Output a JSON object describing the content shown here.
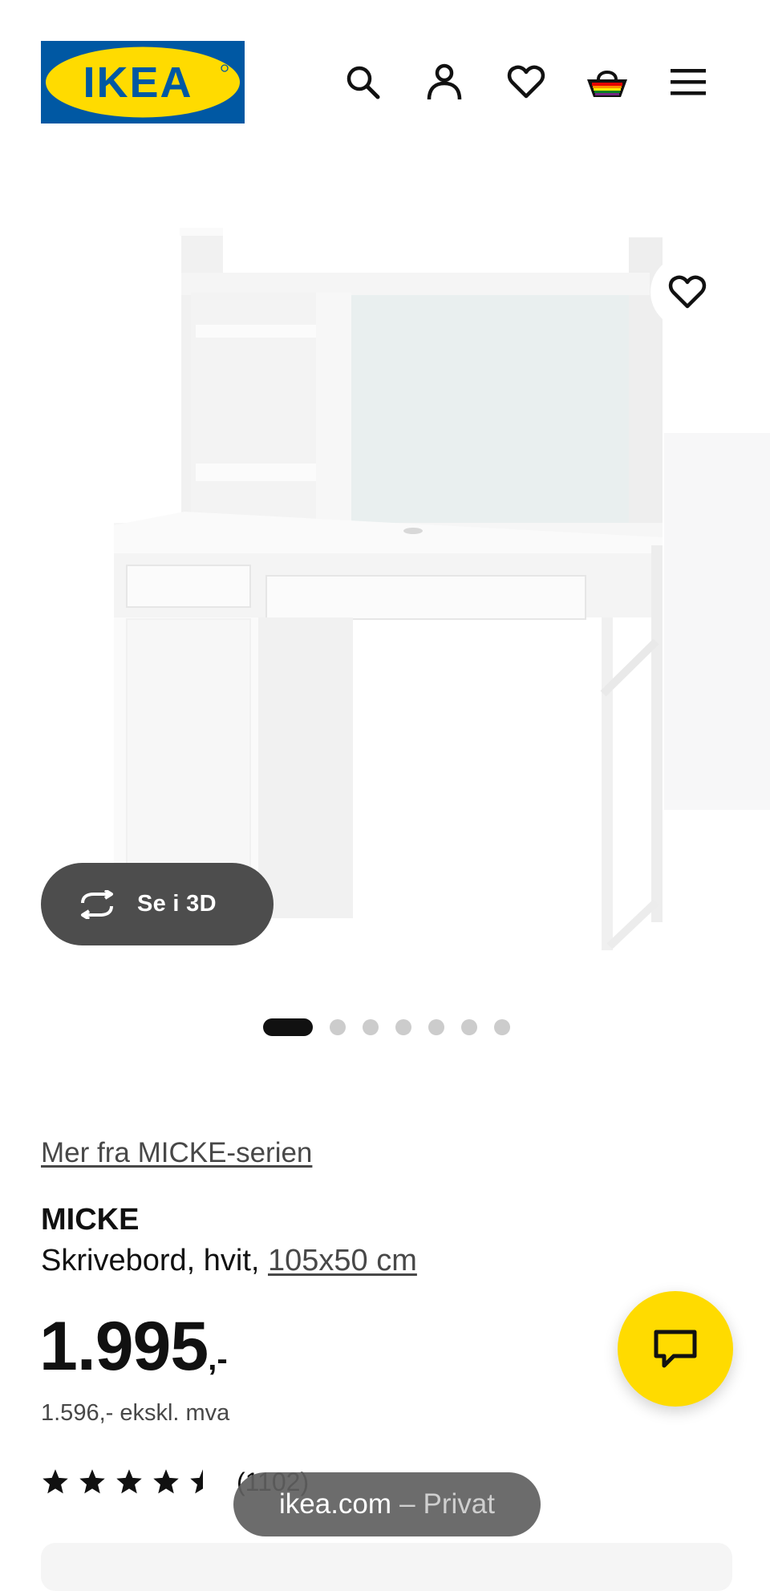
{
  "header": {
    "logo_text": "IKEA",
    "icons": [
      "search-icon",
      "account-icon",
      "heart-icon",
      "basket-icon",
      "menu-icon"
    ]
  },
  "gallery": {
    "view_3d_label": "Se i 3D",
    "image_count": 7,
    "active_index": 0
  },
  "product": {
    "series_link": "Mer fra MICKE-serien",
    "name": "MICKE",
    "description_prefix": "Skrivebord, hvit, ",
    "size_link": "105x50 cm",
    "price_main": "1.995",
    "price_suffix": ",-",
    "price_ex_vat": "1.596,- ekskl. mva",
    "rating": 4.5,
    "review_count_label": "(1102)"
  },
  "browser": {
    "domain": "ikea.com",
    "separator": "–",
    "mode": "Privat"
  },
  "colors": {
    "ikea_blue": "#0058a3",
    "ikea_yellow": "#ffdb00",
    "text": "#111111"
  }
}
